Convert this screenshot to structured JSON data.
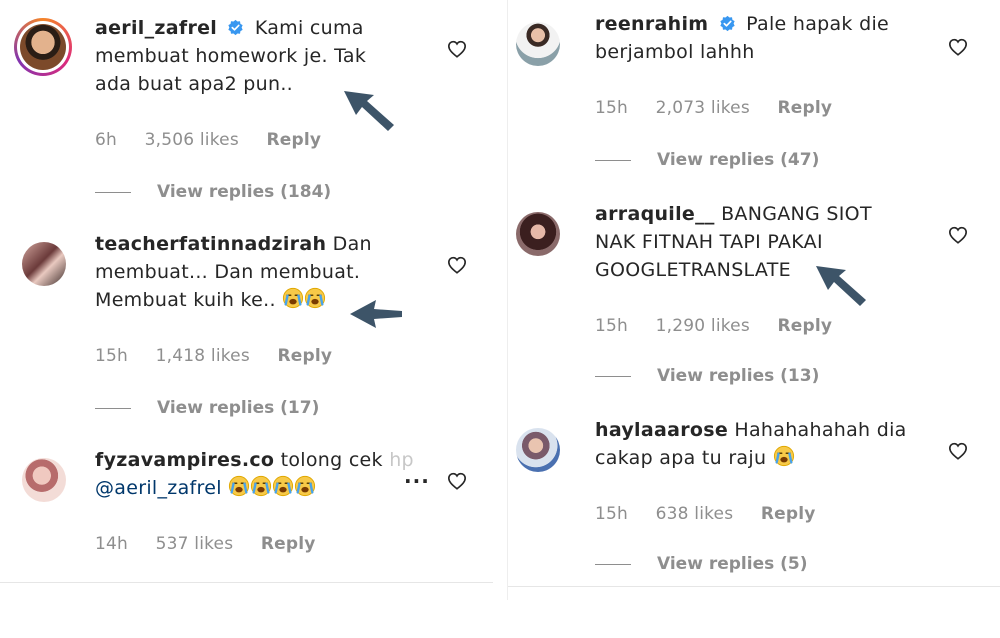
{
  "left": [
    {
      "username": "aeril_zafrel",
      "verified": true,
      "text_lines": [
        "Kami cuma",
        "membuat homework je. Tak",
        "ada buat apa2 pun.."
      ],
      "time": "6h",
      "likes": "3,506 likes",
      "reply": "Reply",
      "view_replies": "View replies (184)"
    },
    {
      "username": "teacherfatinnadzirah",
      "verified": false,
      "text_lines": [
        "Dan",
        "membuat... Dan membuat.",
        "Membuat kuih ke.."
      ],
      "time": "15h",
      "likes": "1,418 likes",
      "reply": "Reply",
      "view_replies": "View replies (17)"
    },
    {
      "username": "fyzavampires.co",
      "verified": false,
      "text_lines": [
        "tolong cek",
        "hp"
      ],
      "mention": "@aeril_zafrel",
      "truncate": "...",
      "time": "14h",
      "likes": "537 likes",
      "reply": "Reply"
    }
  ],
  "right": [
    {
      "username": "reenrahim",
      "verified": true,
      "text_lines": [
        "Pale hapak die",
        "berjambol lahhh"
      ],
      "time": "15h",
      "likes": "2,073 likes",
      "reply": "Reply",
      "view_replies": "View replies (47)"
    },
    {
      "username": "arraquile__",
      "verified": false,
      "text_lines": [
        "BANGANG SIOT",
        "NAK FITNAH TAPI PAKAI",
        "GOOGLETRANSLATE"
      ],
      "time": "15h",
      "likes": "1,290 likes",
      "reply": "Reply",
      "view_replies": "View replies (13)"
    },
    {
      "username": "haylaaarose",
      "verified": false,
      "text_lines": [
        "Hahahahahah dia",
        "cakap apa tu raju"
      ],
      "time": "15h",
      "likes": "638 likes",
      "reply": "Reply",
      "view_replies": "View replies (5)"
    }
  ],
  "colors": {
    "text": "#262626",
    "meta": "#8e8e8e",
    "verified": "#3897f0",
    "mention": "#00376b",
    "arrow": "#3d5468"
  },
  "icons": {
    "like": "heart-outline-icon",
    "verified": "verified-badge-icon",
    "annotation": "arrow-pointer-icon",
    "emoji": "loudly-crying-face-emoji"
  }
}
